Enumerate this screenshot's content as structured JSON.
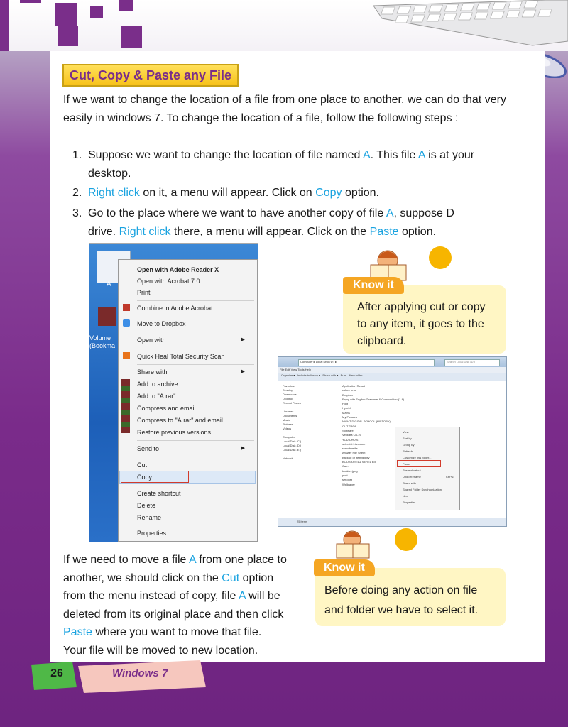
{
  "section_title": "Cut, Copy & Paste any File",
  "intro": "If we want to change the location of a file from one place to another, we can do that very easily in windows 7. To change the location of a file, follow the following steps :",
  "steps": [
    {
      "num": "1.",
      "line1a": "Suppose we want to change the location of file named ",
      "line1_h1": "A",
      "line1b": ". This file ",
      "line1_h2": "A",
      "line1c": " is at your",
      "line2": "desktop."
    },
    {
      "num": "2.",
      "h1": "Right click",
      "a": " on it, a menu will appear. Click  on ",
      "h2": "Copy",
      "b": " option."
    },
    {
      "num": "3.",
      "line1a": "Go to the place where we want to have another copy of file ",
      "line1_h": "A",
      "line1b": ", suppose D",
      "line2_a": "drive. ",
      "line2_h1": "Right click",
      "line2_b": " there, a menu will appear. Click on the ",
      "line2_h2": "Paste",
      "line2_c": " option."
    }
  ],
  "context_menu": {
    "desktop_icon_label": "A",
    "desktop_left_labels": [
      "Volume",
      "(Bookma"
    ],
    "items": [
      {
        "label": "Open with Adobe Reader X",
        "bold": true
      },
      {
        "label": "Open with Acrobat 7.0"
      },
      {
        "label": "Print"
      },
      {
        "label": "Combine in Adobe Acrobat..."
      },
      {
        "label": "Move to Dropbox"
      },
      {
        "label": "Open with",
        "submenu": true
      },
      {
        "label": "Quick Heal Total Security Scan"
      },
      {
        "label": "Share with",
        "submenu": true
      },
      {
        "label": "Add to archive..."
      },
      {
        "label": "Add to \"A.rar\""
      },
      {
        "label": "Compress and email..."
      },
      {
        "label": "Compress to \"A.rar\" and email"
      },
      {
        "label": "Restore previous versions"
      },
      {
        "label": "Send to",
        "submenu": true
      },
      {
        "label": "Cut"
      },
      {
        "label": "Copy"
      },
      {
        "label": "Create shortcut"
      },
      {
        "label": "Delete"
      },
      {
        "label": "Rename"
      },
      {
        "label": "Properties"
      }
    ]
  },
  "explorer": {
    "address": "Computer ▸ Local Disk (D:) ▸",
    "search": "Search Local Disk (D:)",
    "menubar": [
      "File",
      "Edit",
      "View",
      "Tools",
      "Help"
    ],
    "toolbar": [
      "Organize ▾",
      "Include in library ▾",
      "Share with ▾",
      "Burn",
      "New folder"
    ],
    "nav_favorites": [
      "Favorites",
      "Desktop",
      "Downloads",
      "Dropbox",
      "Recent Places"
    ],
    "nav_libraries": [
      "Libraries",
      "Documents",
      "Music",
      "Pictures",
      "Videos"
    ],
    "nav_computer": [
      "Computer",
      "Local Disk (C:)",
      "Local Disk (D:)",
      "Local Disk (E:)"
    ],
    "nav_network": [
      "Network"
    ],
    "files": [
      "Application Result",
      "colour prod",
      "Dropbox",
      "Enjoy with English Grammar & Composition (1-8)",
      "Font",
      "Hybrid",
      "Maths",
      "My Pictures",
      "NIGHT DIGITAL SCHOOL (HISTORY)",
      "OUT DATA",
      "Software",
      "Venkata Ch-19",
      "YOU CHOIS",
      "scientist Literature",
      "scrindmedia",
      "Answer File Sheet",
      "Backup of_textbkgrey",
      "BOOKRASTAL SEREL Ed",
      "Cam",
      "booklet.jpeg",
      "post",
      "set.post",
      "Wallpaper"
    ],
    "status": "25 items",
    "menu": [
      "View",
      "Sort by",
      "Group by",
      "Refresh",
      "Customize this folder...",
      "Paste",
      "Paste shortcut",
      "Undo Rename",
      "Share with",
      "Shared Folder Synchronization",
      "New",
      "Properties"
    ],
    "menu_shortcut": "Ctrl+Z"
  },
  "know_it_1": {
    "tag": "Know it",
    "text_lines": [
      "After applying cut or copy",
      "to any item, it goes to the",
      "clipboard."
    ]
  },
  "move_para": {
    "l1a": "If we need to move a file ",
    "l1h": "A",
    "l1b": " from one place to",
    "l2a": "another, we should click on the ",
    "l2h": "Cut",
    "l2b": " option",
    "l3a": "from the menu instead of copy, file ",
    "l3h": "A",
    "l3b": " will be",
    "l4": "deleted from its original place and then click",
    "l5h": "Paste",
    "l5b": " where you want to move that file.",
    "l6": "Your file will be moved to new location."
  },
  "know_it_2": {
    "tag": "Know it",
    "text_lines": [
      "Before doing any action on file",
      "and folder we have to select it."
    ]
  },
  "footer": {
    "page_number": "26",
    "label": "Windows 7"
  },
  "colors": {
    "accent": "#1aa3e0",
    "purple": "#7a2e8a",
    "yellow": "#f7c21a",
    "orange": "#f5a623",
    "pink": "#f6c7be",
    "green": "#4fb847"
  }
}
